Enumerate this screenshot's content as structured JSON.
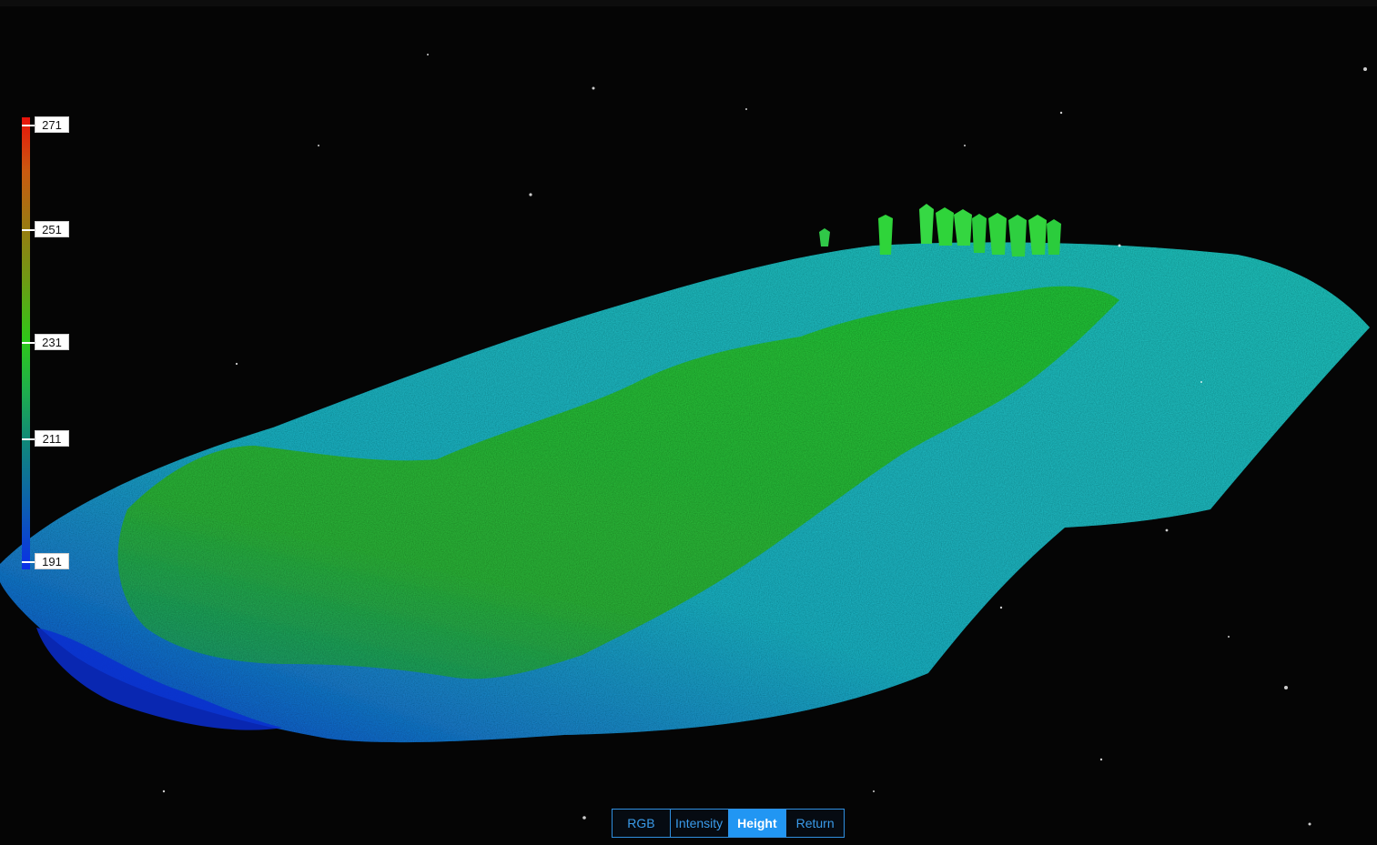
{
  "viewer": {
    "background_color": "#050505",
    "colors": {
      "low": "#0a2fe8",
      "ground": "#1fc8c8",
      "mid": "#2fc818",
      "high": "#e8120b"
    }
  },
  "color_scale": {
    "labels": [
      "271",
      "251",
      "231",
      "211",
      "191"
    ]
  },
  "mode_switcher": {
    "buttons": [
      {
        "label": "RGB",
        "active": false
      },
      {
        "label": "Intensity",
        "active": false
      },
      {
        "label": "Height",
        "active": true
      },
      {
        "label": "Return",
        "active": false
      }
    ],
    "active_color": "#2196f3"
  }
}
